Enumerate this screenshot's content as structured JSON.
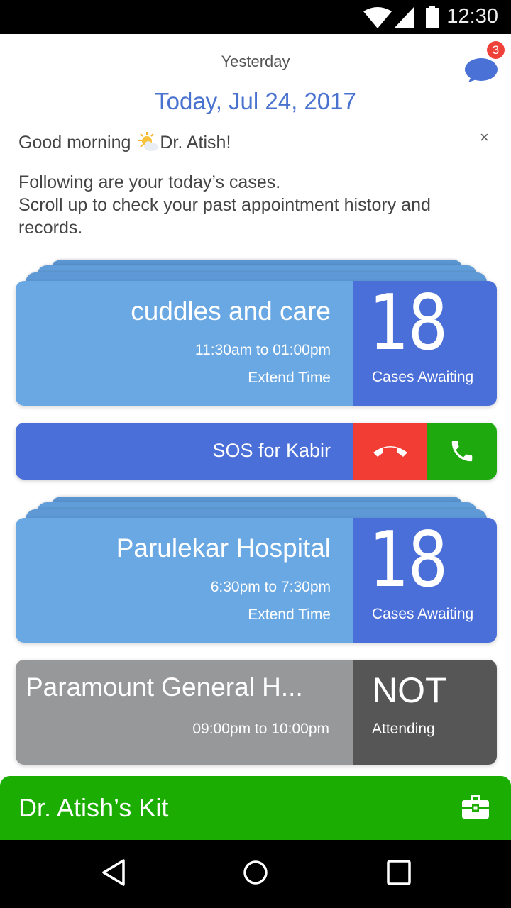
{
  "status_bar": {
    "time": "12:30",
    "icons": [
      "wifi-icon",
      "signal-icon",
      "battery-icon"
    ]
  },
  "header": {
    "previous_day_label": "Yesterday",
    "current_date": "Today, Jul 24, 2017",
    "messages_icon": "chat-bubble-icon",
    "unread_count": "3"
  },
  "greeting": {
    "text_before": "Good morning ",
    "emoji": "sun-behind-cloud",
    "text_after": "Dr. Atish!",
    "dismiss_label": "×",
    "intro_line1": "Following are your today’s cases.",
    "intro_line2": "Scroll up to check your past appointment history and records."
  },
  "appointments": [
    {
      "clinic": "cuddles and care",
      "time_range": "11:30am to 01:00pm",
      "action": "Extend Time",
      "count": "18",
      "count_label": "Cases Awaiting"
    },
    {
      "clinic": "Parulekar Hospital",
      "time_range": "6:30pm to 7:30pm",
      "action": "Extend Time",
      "count": "18",
      "count_label": "Cases Awaiting"
    },
    {
      "clinic": "Paramount General H...",
      "time_range": "09:00pm to 10:00pm",
      "status": "NOT",
      "status_label": "Attending"
    }
  ],
  "sos": {
    "label": "SOS for Kabir",
    "decline_icon": "hang-up-icon",
    "accept_icon": "phone-icon"
  },
  "kit": {
    "label": "Dr. Atish’s Kit",
    "icon": "medical-kit-icon"
  },
  "colors": {
    "accent_blue": "#4a6fd8",
    "card_blue": "#6aa8e3",
    "date_blue": "#4a72cf",
    "decline_red": "#f23d34",
    "accept_green": "#1eaa0f",
    "kit_green": "#1cad03",
    "inactive_grey": "#97989a",
    "inactive_dark": "#565656"
  }
}
